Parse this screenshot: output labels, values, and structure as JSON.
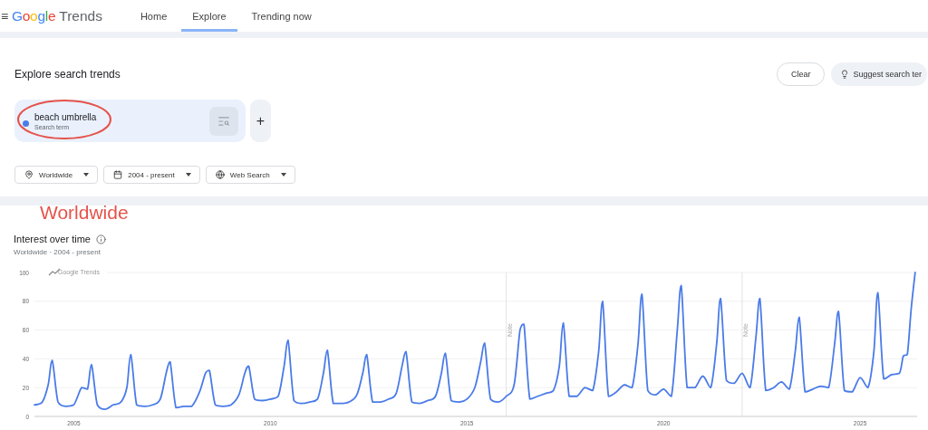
{
  "header": {
    "menu_icon": "≡",
    "logo": {
      "brand": "Google",
      "product": "Trends"
    },
    "tabs": [
      {
        "label": "Home",
        "selected": false
      },
      {
        "label": "Explore",
        "selected": true
      },
      {
        "label": "Trending now",
        "selected": false
      }
    ]
  },
  "explore": {
    "title": "Explore search trends",
    "clear_button": "Clear",
    "suggest_button": "Suggest search ter",
    "terms": [
      {
        "term": "beach umbrella",
        "subtitle": "Search term",
        "color": "#4a7be8"
      }
    ],
    "add_button": "+",
    "filters": [
      {
        "kind": "location",
        "label": "Worldwide"
      },
      {
        "kind": "date",
        "label": "2004 - present"
      },
      {
        "kind": "property",
        "label": "Web Search"
      }
    ]
  },
  "annotation": {
    "text": "Worldwide"
  },
  "interest": {
    "title": "Interest over time",
    "subtitle": "Worldwide · 2004 - present",
    "chart_label": "Google Trends",
    "chart_data": {
      "type": "line",
      "xlim": [
        2004,
        2026.45
      ],
      "ylim": [
        0,
        100
      ],
      "xticks": [
        2005,
        2010,
        2015,
        2020,
        2025
      ],
      "yticks": [
        0,
        20,
        40,
        60,
        80,
        100
      ],
      "x": [
        2004,
        2004.2,
        2004.35,
        2004.45,
        2004.6,
        2004.8,
        2005,
        2005.2,
        2005.35,
        2005.45,
        2005.6,
        2005.8,
        2006,
        2006.2,
        2006.35,
        2006.45,
        2006.6,
        2006.8,
        2007,
        2007.2,
        2007.35,
        2007.45,
        2007.6,
        2007.8,
        2008,
        2008.2,
        2008.35,
        2008.45,
        2008.6,
        2008.8,
        2009,
        2009.2,
        2009.35,
        2009.45,
        2009.6,
        2009.8,
        2010,
        2010.2,
        2010.35,
        2010.45,
        2010.6,
        2010.8,
        2011,
        2011.2,
        2011.35,
        2011.45,
        2011.6,
        2011.8,
        2012,
        2012.2,
        2012.35,
        2012.45,
        2012.6,
        2012.8,
        2013,
        2013.2,
        2013.35,
        2013.45,
        2013.6,
        2013.8,
        2014,
        2014.2,
        2014.35,
        2014.45,
        2014.6,
        2014.8,
        2015,
        2015.2,
        2015.35,
        2015.45,
        2015.6,
        2015.8,
        2016,
        2016.2,
        2016.35,
        2016.45,
        2016.6,
        2016.8,
        2017,
        2017.2,
        2017.35,
        2017.45,
        2017.6,
        2017.8,
        2018,
        2018.2,
        2018.35,
        2018.45,
        2018.6,
        2018.8,
        2019,
        2019.2,
        2019.35,
        2019.45,
        2019.6,
        2019.8,
        2020,
        2020.2,
        2020.35,
        2020.45,
        2020.6,
        2020.8,
        2021,
        2021.2,
        2021.35,
        2021.45,
        2021.6,
        2021.8,
        2022,
        2022.2,
        2022.35,
        2022.45,
        2022.6,
        2022.8,
        2023,
        2023.2,
        2023.35,
        2023.45,
        2023.6,
        2023.8,
        2024,
        2024.2,
        2024.35,
        2024.45,
        2024.6,
        2024.8,
        2025,
        2025.2,
        2025.35,
        2025.45,
        2025.6,
        2025.8,
        2026,
        2026.1,
        2026.2,
        2026.3,
        2026.4
      ],
      "series": [
        {
          "color": "#4a7be8",
          "values": [
            8,
            10,
            22,
            39,
            10,
            7,
            8,
            20,
            19,
            36,
            8,
            5,
            8,
            10,
            20,
            43,
            8,
            7,
            8,
            12,
            30,
            38,
            6,
            7,
            7,
            17,
            30,
            32,
            8,
            7,
            8,
            15,
            30,
            35,
            12,
            11,
            12,
            14,
            35,
            53,
            11,
            9,
            10,
            12,
            30,
            46,
            9,
            9,
            10,
            15,
            30,
            43,
            10,
            10,
            12,
            16,
            35,
            45,
            10,
            9,
            11,
            14,
            30,
            44,
            11,
            10,
            12,
            20,
            38,
            51,
            12,
            10,
            14,
            22,
            60,
            64,
            12,
            14,
            16,
            18,
            35,
            65,
            14,
            14,
            20,
            18,
            45,
            80,
            14,
            17,
            22,
            20,
            50,
            85,
            18,
            15,
            19,
            14,
            60,
            91,
            20,
            20,
            28,
            20,
            50,
            82,
            25,
            23,
            30,
            20,
            55,
            82,
            18,
            20,
            24,
            19,
            45,
            69,
            17,
            19,
            21,
            20,
            50,
            73,
            18,
            17,
            27,
            20,
            45,
            86,
            26,
            29,
            30,
            42,
            43,
            75,
            100
          ]
        }
      ],
      "grid": true,
      "ref_lines": [
        {
          "axis": "x",
          "value": 2016,
          "label": "Note"
        },
        {
          "axis": "x",
          "value": 2022,
          "label": "Note"
        }
      ]
    }
  }
}
